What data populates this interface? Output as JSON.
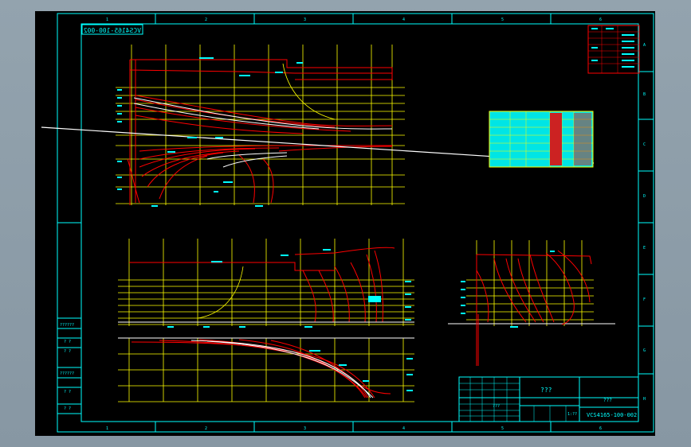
{
  "drawing": {
    "title_mirrored": "VCS4165-100-002",
    "drawing_number": "VCS4165-100-002",
    "title_block_name": "???",
    "title_block_sub": "???",
    "title_block_scale": "1:??",
    "title_block_sheet": "???",
    "border_cols": [
      "1",
      "2",
      "3",
      "4",
      "5",
      "6"
    ],
    "border_rows": [
      "A",
      "B",
      "C",
      "D",
      "E",
      "F",
      "G",
      "H"
    ],
    "left_stamp": [
      "??????",
      "? ?",
      "? ?",
      "??????",
      "? ?",
      "? ?"
    ]
  },
  "colors": {
    "background": "#000000",
    "frame": "#00ffff",
    "grid": "#ffff00",
    "hull": "#ff0000",
    "waterline": "#ffffff",
    "annotation": "#00ffff",
    "table_fill": "#00e5e5"
  }
}
